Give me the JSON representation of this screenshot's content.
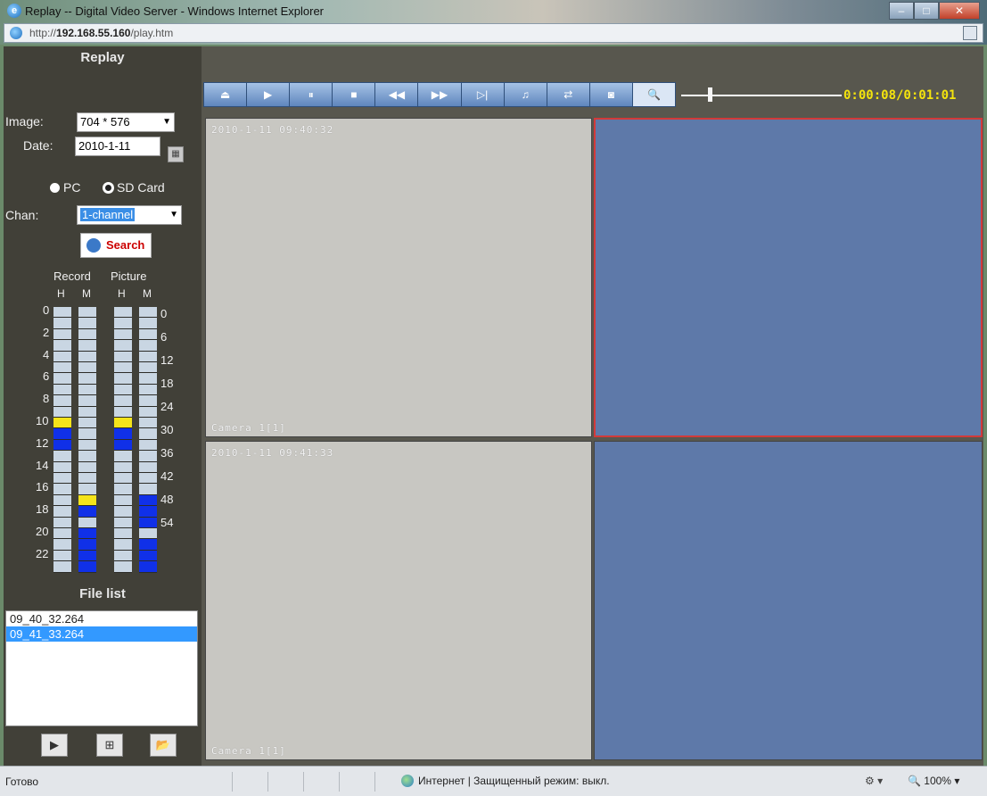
{
  "window": {
    "title": "Replay -- Digital Video Server - Windows Internet Explorer",
    "url_prefix": "http://",
    "url_host": "192.168.55.160",
    "url_path": "/play.htm"
  },
  "sidebar": {
    "title": "Replay",
    "image_label": "Image:",
    "image_value": "704 * 576",
    "date_label": "Date:",
    "date_value": "2010-1-11",
    "source_options": [
      "PC",
      "SD Card"
    ],
    "source_selected": "SD Card",
    "chan_label": "Chan:",
    "chan_value": "1-channel",
    "search_label": "Search",
    "record_label": "Record",
    "picture_label": "Picture",
    "col_h": "H",
    "col_m": "M",
    "hours_labels": [
      "0",
      "2",
      "4",
      "6",
      "8",
      "10",
      "12",
      "14",
      "16",
      "18",
      "20",
      "22"
    ],
    "minutes_labels": [
      "0",
      "6",
      "12",
      "18",
      "24",
      "30",
      "36",
      "42",
      "48",
      "54"
    ],
    "file_list_title": "File list",
    "files": [
      "09_40_32.264",
      "09_41_33.264"
    ],
    "selected_file": "09_41_33.264"
  },
  "player": {
    "timecode": "0:00:08/0:01:01"
  },
  "status": {
    "ready": "Готово",
    "zone": "Интернет | Защищенный режим: выкл.",
    "zoom": "100%"
  },
  "colors": {
    "record_yellow": "#f5e41a",
    "record_blue": "#1030e8",
    "empty_segment": "#c9d6e3",
    "video_blue": "#5e79a9",
    "active_border": "#d23a3a",
    "timecode": "#f4e40d"
  }
}
